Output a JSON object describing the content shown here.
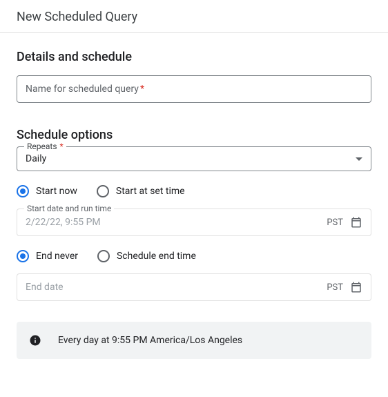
{
  "header": {
    "title": "New Scheduled Query"
  },
  "details": {
    "section_title": "Details and schedule",
    "name_placeholder": "Name for scheduled query",
    "name_required_marker": "*"
  },
  "schedule": {
    "section_title": "Schedule options",
    "repeats_label": "Repeats",
    "repeats_required_marker": "*",
    "repeats_value": "Daily",
    "start_radio": {
      "now": "Start now",
      "set_time": "Start at set time",
      "selected": "now"
    },
    "start_date": {
      "label": "Start date and run time",
      "value": "2/22/22, 9:55 PM",
      "tz": "PST"
    },
    "end_radio": {
      "never": "End never",
      "set_time": "Schedule end time",
      "selected": "never"
    },
    "end_date": {
      "placeholder": "End date",
      "tz": "PST"
    },
    "summary": "Every day at 9:55 PM America/Los Angeles"
  }
}
